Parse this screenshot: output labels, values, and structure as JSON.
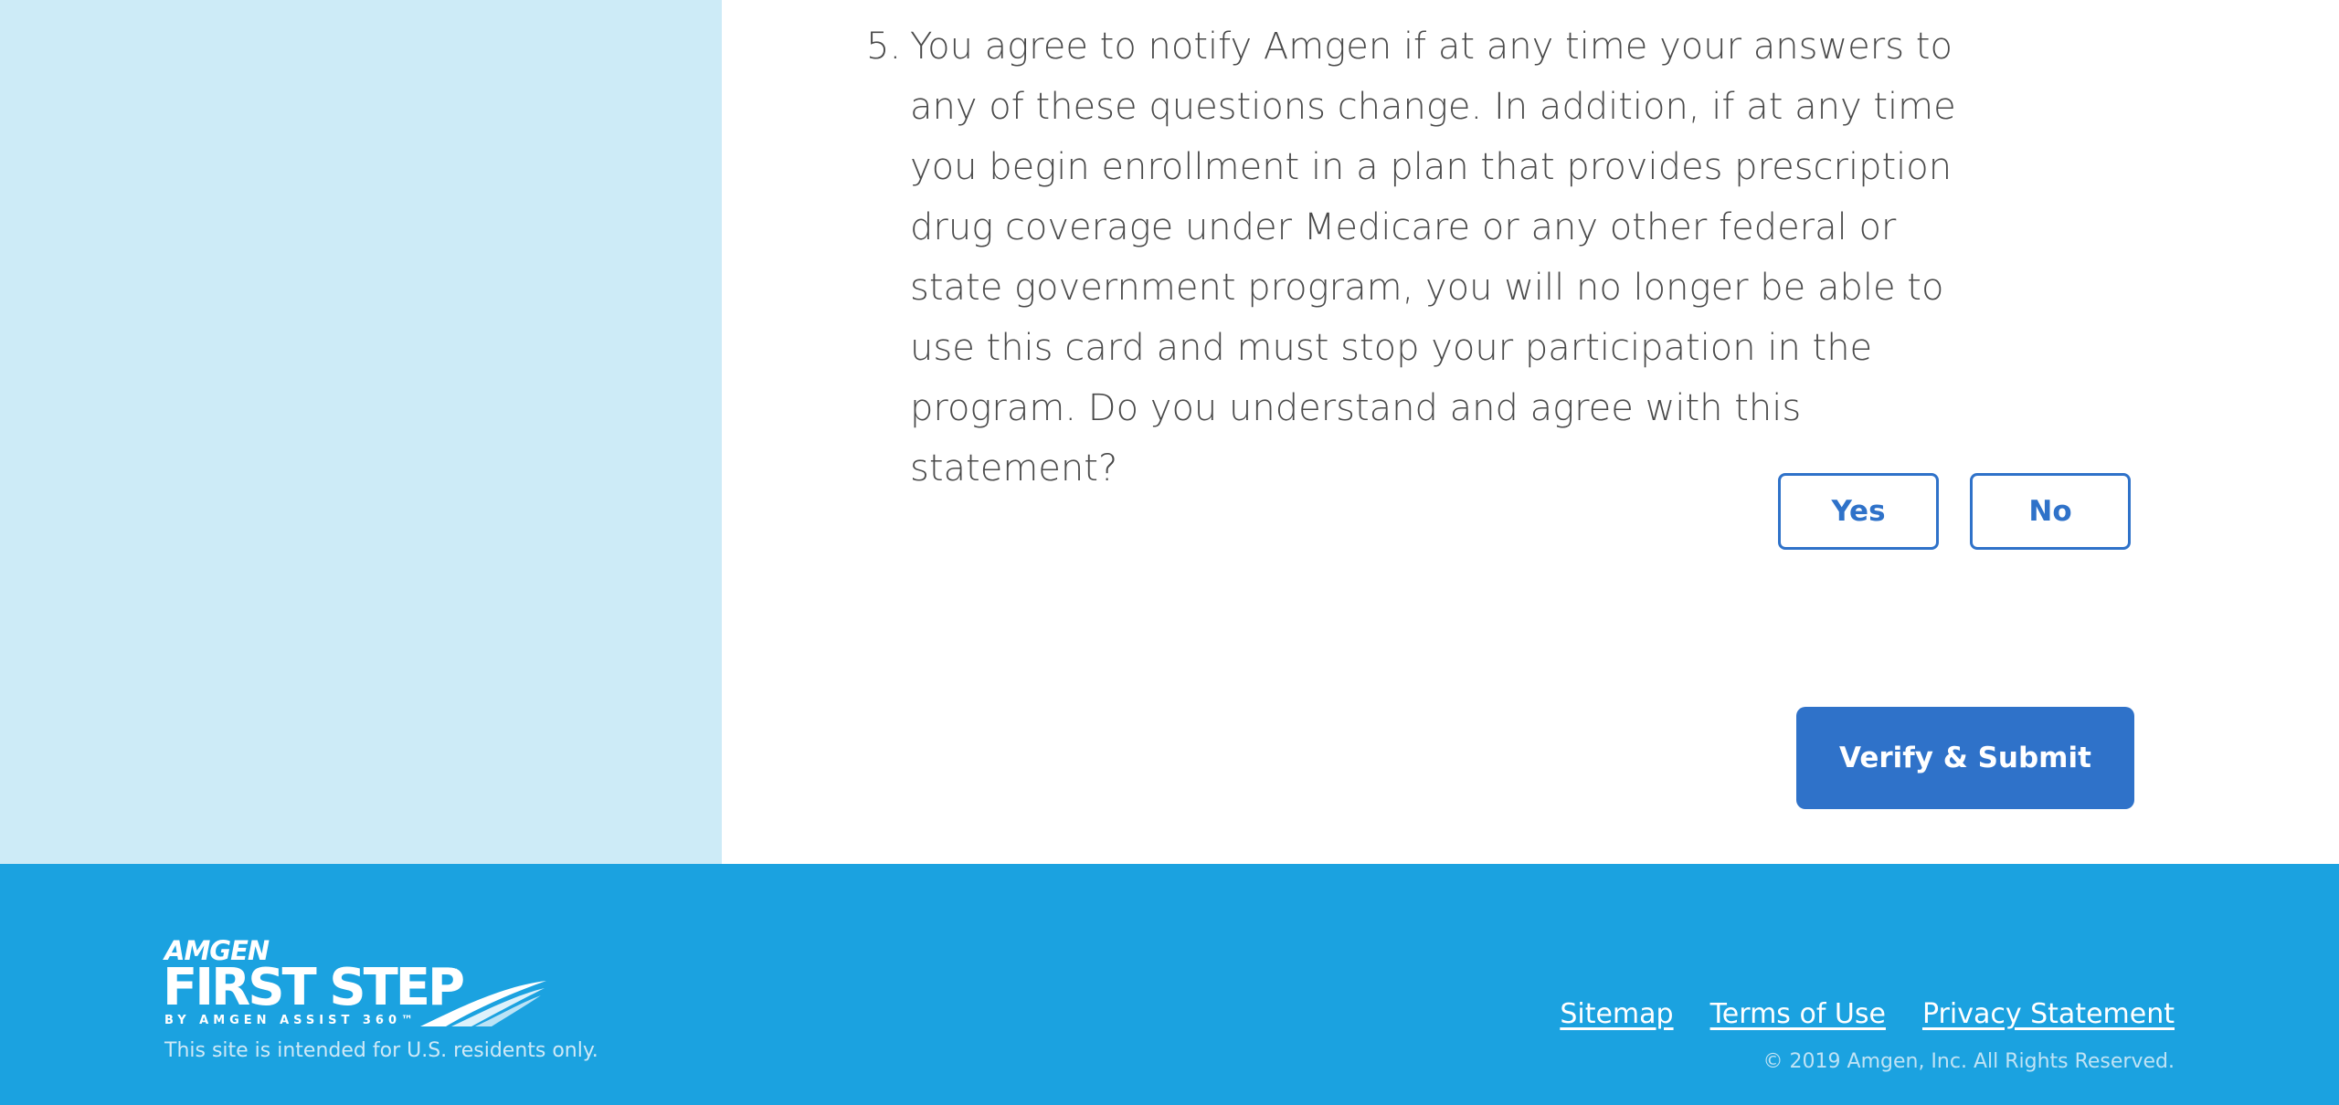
{
  "question": {
    "number": "5.",
    "text": "You agree to notify Amgen if at any time your answers to any of these questions change. In addition, if at any time you begin enrollment in a plan that provides prescription drug coverage under Medicare or any other federal or state government program, you will no longer be able to use this card and must stop your participation in the program. Do you understand and agree with this statement?"
  },
  "answers": {
    "yes_label": "Yes",
    "no_label": "No"
  },
  "submit_label": "Verify & Submit",
  "footer": {
    "logo": {
      "brand": "AMGEN",
      "name": "FIRST STEP",
      "trademark": "™",
      "tagline": "BY AMGEN ASSIST 360™"
    },
    "residents_note": "This site is intended for U.S. residents only.",
    "links": {
      "sitemap": "Sitemap",
      "terms": "Terms of Use",
      "privacy": "Privacy Statement"
    },
    "copyright": "© 2019 Amgen, Inc. All Rights Reserved."
  },
  "colors": {
    "left_panel": "#cdebf7",
    "footer": "#1ba2e0",
    "accent": "#2f72c9"
  }
}
